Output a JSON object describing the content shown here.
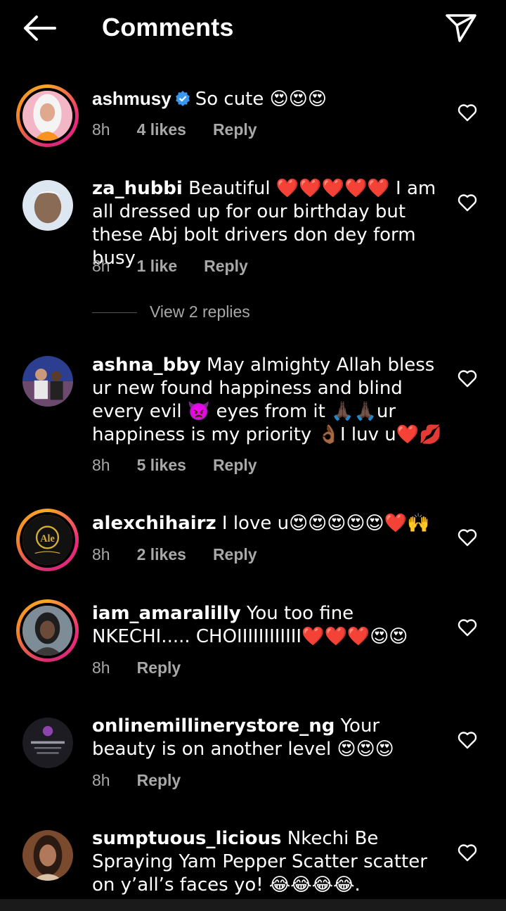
{
  "header": {
    "title": "Comments"
  },
  "view_replies": "View 2 replies",
  "comments": [
    {
      "user": "ashmusy",
      "text": "So cute 😍😍😍",
      "time": "8h",
      "likes": "4 likes",
      "reply": "Reply"
    },
    {
      "user": "za_hubbi",
      "text": "Beautiful ❤️❤️❤️❤️❤️ I am all dressed up for our birthday but these Abj bolt drivers don dey form busy",
      "time": "8h",
      "likes": "1 like",
      "reply": "Reply"
    },
    {
      "user": "ashna_bby",
      "text": "May almighty Allah bless ur new found happiness and blind every evil 👿 eyes from it 🙏🏿🙏🏿ur happiness is my priority 👌🏾I luv u❤️💋",
      "time": "8h",
      "likes": "5 likes",
      "reply": "Reply"
    },
    {
      "user": "alexchihairz",
      "text": "I love u😍😍😍😍😍❤️🙌",
      "time": "8h",
      "likes": "2 likes",
      "reply": "Reply"
    },
    {
      "user": "iam_amaralilly",
      "text": "You too fine NKECHI..... CHOIIIIIIIIIIII❤️❤️❤️😍😍",
      "time": "8h",
      "reply": "Reply"
    },
    {
      "user": "onlinemillinerystore_ng",
      "text": "Your beauty is on another level 😍😍😍",
      "time": "8h",
      "reply": "Reply"
    },
    {
      "user": "sumptuous_licious",
      "text": "Nkechi Be Spraying Yam Pepper Scatter scatter on y’all’s faces yo! 😂😂😂😂.",
      "time": "",
      "reply": ""
    }
  ]
}
